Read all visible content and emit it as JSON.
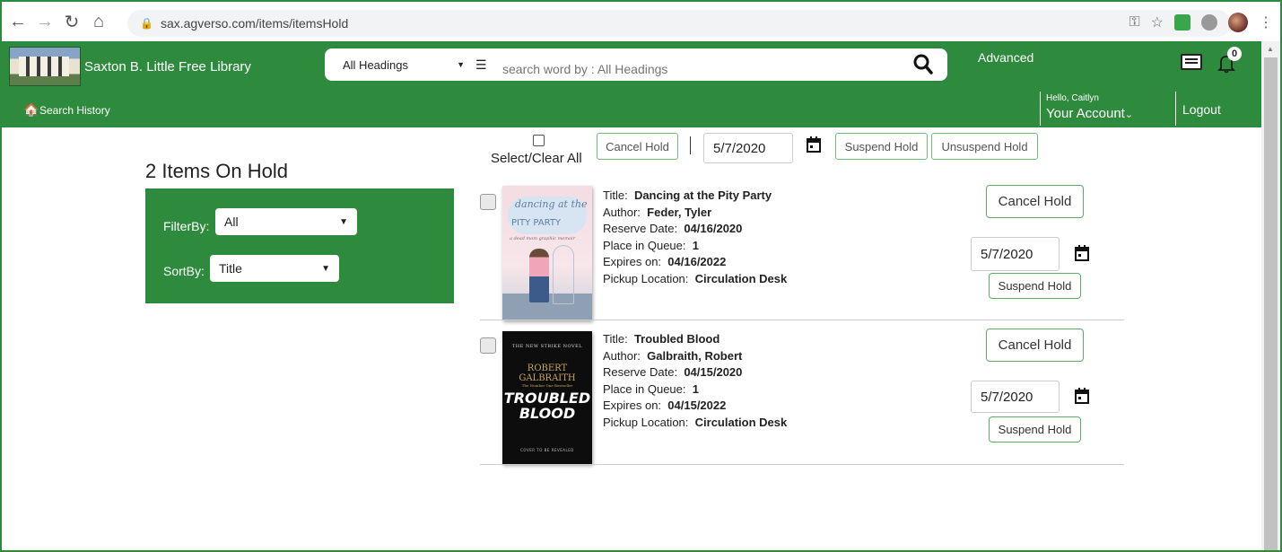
{
  "browser": {
    "url": "sax.agverso.com/items/itemsHold"
  },
  "header": {
    "library_name": "Saxton B. Little Free Library",
    "search": {
      "heading_selected": "All Headings",
      "placeholder": "search word by : All Headings"
    },
    "advanced_label": "Advanced",
    "notification_count": "0",
    "search_history_label": "Search History",
    "greeting": "Hello, Caitlyn",
    "account_label": "Your Account",
    "logout_label": "Logout"
  },
  "holds": {
    "count_title": "2 Items On Hold",
    "filter_label": "FilterBy:",
    "filter_value": "All",
    "sort_label": "SortBy:",
    "sort_value": "Title",
    "toolbar": {
      "select_all_label": "Select/Clear All",
      "cancel_hold_label": "Cancel Hold",
      "date_value": "5/7/2020",
      "suspend_hold_label": "Suspend Hold",
      "unsuspend_hold_label": "Unsuspend Hold"
    },
    "field_labels": {
      "title": "Title:",
      "author": "Author:",
      "reserve_date": "Reserve Date:",
      "place_in_queue": "Place in Queue:",
      "expires_on": "Expires on:",
      "pickup_location": "Pickup Location:"
    },
    "items": [
      {
        "title": "Dancing at the Pity Party",
        "author": "Feder, Tyler",
        "reserve_date": "04/16/2020",
        "place_in_queue": "1",
        "expires_on": "04/16/2022",
        "pickup_location": "Circulation Desk",
        "cancel_label": "Cancel Hold",
        "suspend_date": "5/7/2020",
        "suspend_label": "Suspend Hold",
        "cover": {
          "line1": "dancing at the",
          "line2": "PITY PARTY",
          "line3": "a dead mom graphic memoir"
        }
      },
      {
        "title": "Troubled Blood",
        "author": "Galbraith, Robert",
        "reserve_date": "04/15/2020",
        "place_in_queue": "1",
        "expires_on": "04/15/2022",
        "pickup_location": "Circulation Desk",
        "cancel_label": "Cancel Hold",
        "suspend_date": "5/7/2020",
        "suspend_label": "Suspend Hold",
        "cover": {
          "series": "THE NEW STRIKE NOVEL",
          "author": "ROBERT GALBRAITH",
          "tagline": "The Number One Bestseller",
          "title": "TROUBLED BLOOD",
          "footer": "COVER TO BE REVEALED"
        }
      }
    ]
  },
  "colors": {
    "brand_green": "#2e8b3e",
    "button_border": "#5cae69"
  }
}
